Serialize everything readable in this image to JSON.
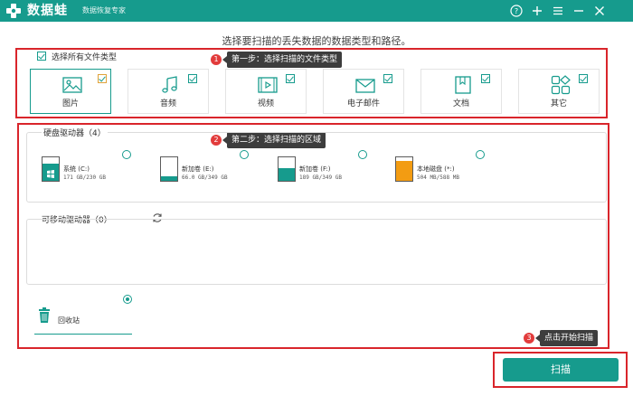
{
  "titlebar": {
    "app_name": "数据蛙",
    "app_subtitle": "数据恢复专家"
  },
  "instruction": "选择要扫描的丢失数据的数据类型和路径。",
  "file_types": {
    "select_all_label": "选择所有文件类型",
    "items": [
      {
        "label": "图片",
        "icon": "image-icon",
        "checked": true
      },
      {
        "label": "音频",
        "icon": "music-icon",
        "checked": true
      },
      {
        "label": "视频",
        "icon": "video-icon",
        "checked": true
      },
      {
        "label": "电子邮件",
        "icon": "email-icon",
        "checked": true
      },
      {
        "label": "文档",
        "icon": "document-icon",
        "checked": true
      },
      {
        "label": "其它",
        "icon": "other-icon",
        "checked": true
      }
    ]
  },
  "steps": {
    "step1": {
      "num": "1",
      "text": "第一步：选择扫描的文件类型"
    },
    "step2": {
      "num": "2",
      "text": "第二步：选择扫描的区域"
    },
    "step3": {
      "num": "3",
      "text": "点击开始扫描"
    }
  },
  "hard_drives": {
    "title": "硬盘驱动器（4）",
    "items": [
      {
        "name": "系统 (C:)",
        "size": "171 GB/230 GB",
        "fill": 0.74,
        "color": "#169b8d"
      },
      {
        "name": "新加卷 (E:)",
        "size": "66.0 GB/349 GB",
        "fill": 0.19,
        "color": "#169b8d"
      },
      {
        "name": "新加卷 (F:)",
        "size": "189 GB/349 GB",
        "fill": 0.54,
        "color": "#169b8d"
      },
      {
        "name": "本地磁盘 (*:)",
        "size": "504 MB/588 MB",
        "fill": 0.86,
        "color": "#f39c12"
      }
    ]
  },
  "removable": {
    "title": "可移动驱动器（0）"
  },
  "recycle_bin": {
    "label": "回收站"
  },
  "scan_button": "扫描",
  "colors": {
    "accent": "#169b8d",
    "highlight": "#d9252b",
    "tooltip": "#3d3d3d"
  }
}
